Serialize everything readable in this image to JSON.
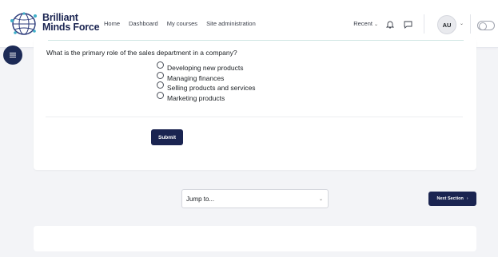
{
  "brand": {
    "line1": "Brilliant",
    "line2": "Minds Force",
    "tagline": "",
    "accent": "#1a2451",
    "logo_icon": "globe-network-icon"
  },
  "nav": {
    "links": [
      "Home",
      "Dashboard",
      "My courses",
      "Site administration"
    ],
    "recent_label": "Recent",
    "avatar_initials": "AU",
    "icons": [
      "bell-icon",
      "chat-icon",
      "chevron-down-icon",
      "theme-toggle"
    ]
  },
  "drawer": {
    "icon": "list-icon"
  },
  "quiz": {
    "question": "What is the primary role of the sales department in a company?",
    "options": [
      "Developing new products",
      "Managing finances",
      "Selling products and services",
      "Marketing products"
    ],
    "submit_label": "Submit"
  },
  "navigation": {
    "jump_label": "Jump to...",
    "next_label": "Next Section"
  }
}
